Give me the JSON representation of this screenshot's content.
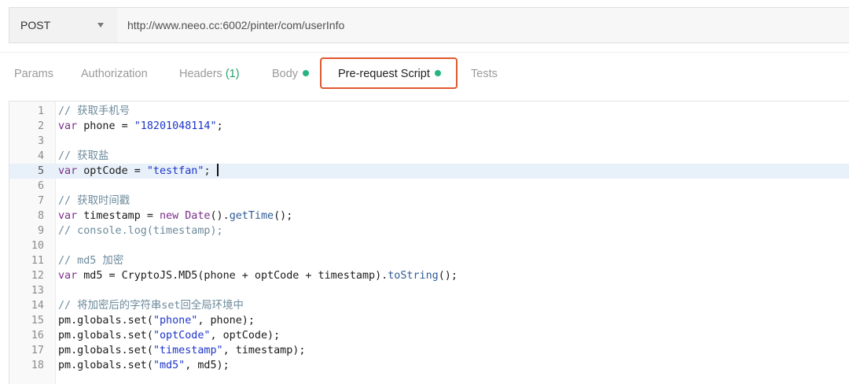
{
  "request": {
    "method": "POST",
    "url": "http://www.neeo.cc:6002/pinter/com/userInfo"
  },
  "tabs": [
    {
      "label": "Params"
    },
    {
      "label": "Authorization"
    },
    {
      "label": "Headers",
      "count": "(1)"
    },
    {
      "label": "Body",
      "has_dot": true
    },
    {
      "label": "Pre-request Script",
      "has_dot": true,
      "active": true
    },
    {
      "label": "Tests"
    }
  ],
  "colors": {
    "dot": "#26b47f",
    "highlight_box": "#e0582f",
    "comment": "#6c8a9c",
    "keyword": "#7a2d8a",
    "string": "#1d35c9",
    "active_line_bg": "#e8f1fa"
  },
  "editor": {
    "active_line": 5,
    "lines": [
      [
        [
          "comment",
          "// 获取手机号"
        ]
      ],
      [
        [
          "keyword",
          "var"
        ],
        [
          "plain",
          " phone = "
        ],
        [
          "string",
          "\"18201048114\""
        ],
        [
          "plain",
          ";"
        ]
      ],
      [],
      [
        [
          "comment",
          "// 获取盐"
        ]
      ],
      [
        [
          "keyword",
          "var"
        ],
        [
          "plain",
          " optCode = "
        ],
        [
          "string",
          "\"testfan\""
        ],
        [
          "plain",
          "; "
        ],
        [
          "cursor",
          ""
        ]
      ],
      [],
      [
        [
          "comment",
          "// 获取时间戳"
        ]
      ],
      [
        [
          "keyword",
          "var"
        ],
        [
          "plain",
          " timestamp = "
        ],
        [
          "keyword",
          "new"
        ],
        [
          "plain",
          " "
        ],
        [
          "keyword",
          "Date"
        ],
        [
          "plain",
          "()."
        ],
        [
          "method",
          "getTime"
        ],
        [
          "plain",
          "();"
        ]
      ],
      [
        [
          "comment",
          "// console.log(timestamp);"
        ]
      ],
      [],
      [
        [
          "comment",
          "// md5 加密"
        ]
      ],
      [
        [
          "keyword",
          "var"
        ],
        [
          "plain",
          " md5 = CryptoJS.MD5(phone + optCode + timestamp)."
        ],
        [
          "method",
          "toString"
        ],
        [
          "plain",
          "();"
        ]
      ],
      [],
      [
        [
          "comment",
          "// 将加密后的字符串set回全局环境中"
        ]
      ],
      [
        [
          "plain",
          "pm.globals.set("
        ],
        [
          "string",
          "\"phone\""
        ],
        [
          "plain",
          ", phone);"
        ]
      ],
      [
        [
          "plain",
          "pm.globals.set("
        ],
        [
          "string",
          "\"optCode\""
        ],
        [
          "plain",
          ", optCode);"
        ]
      ],
      [
        [
          "plain",
          "pm.globals.set("
        ],
        [
          "string",
          "\"timestamp\""
        ],
        [
          "plain",
          ", timestamp);"
        ]
      ],
      [
        [
          "plain",
          "pm.globals.set("
        ],
        [
          "string",
          "\"md5\""
        ],
        [
          "plain",
          ", md5);"
        ]
      ]
    ]
  }
}
